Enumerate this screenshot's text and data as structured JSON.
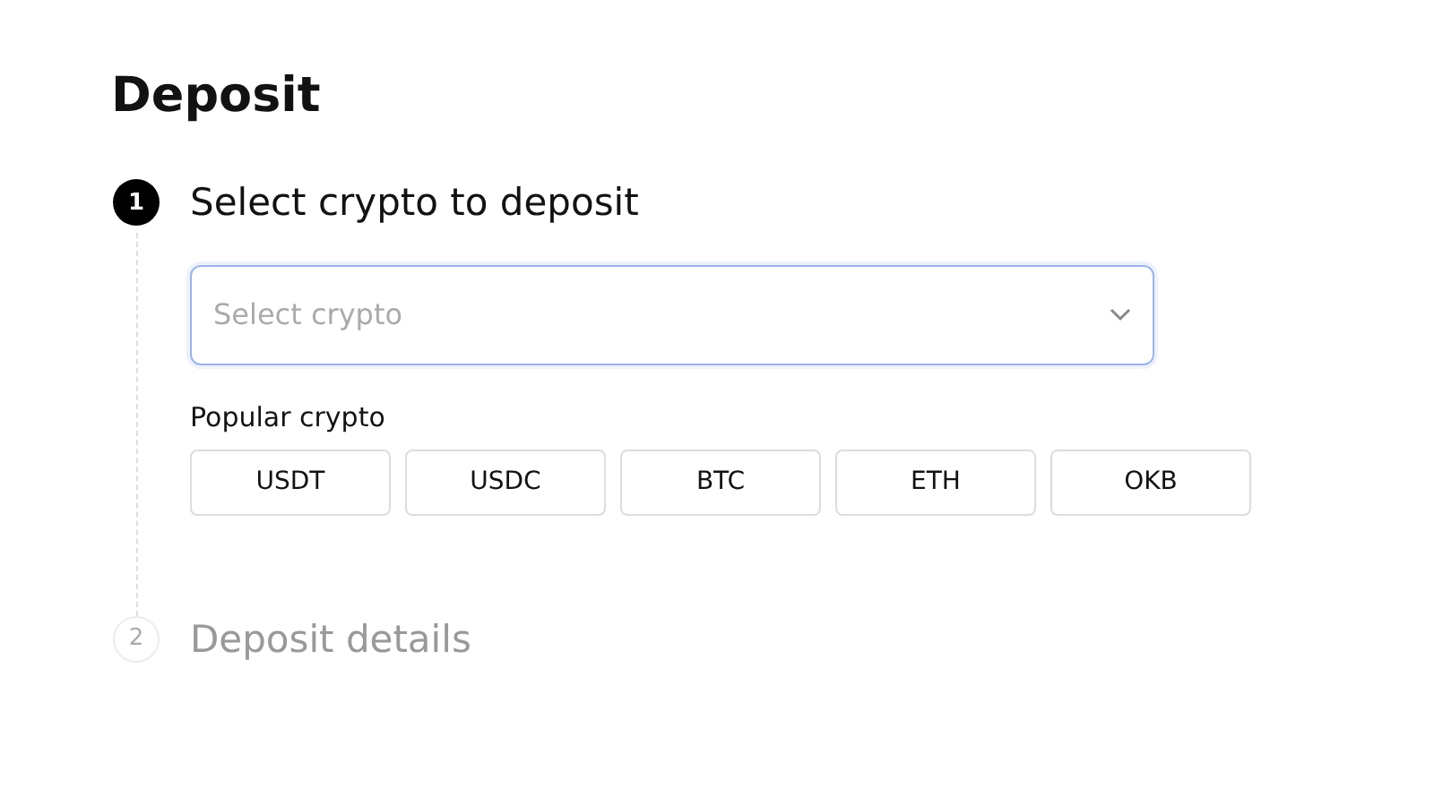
{
  "title": "Deposit",
  "steps": [
    {
      "number": "1",
      "title": "Select crypto to deposit",
      "active": true,
      "select": {
        "placeholder": "Select crypto"
      },
      "popular_label": "Popular crypto",
      "popular": [
        "USDT",
        "USDC",
        "BTC",
        "ETH",
        "OKB"
      ]
    },
    {
      "number": "2",
      "title": "Deposit details",
      "active": false
    }
  ]
}
